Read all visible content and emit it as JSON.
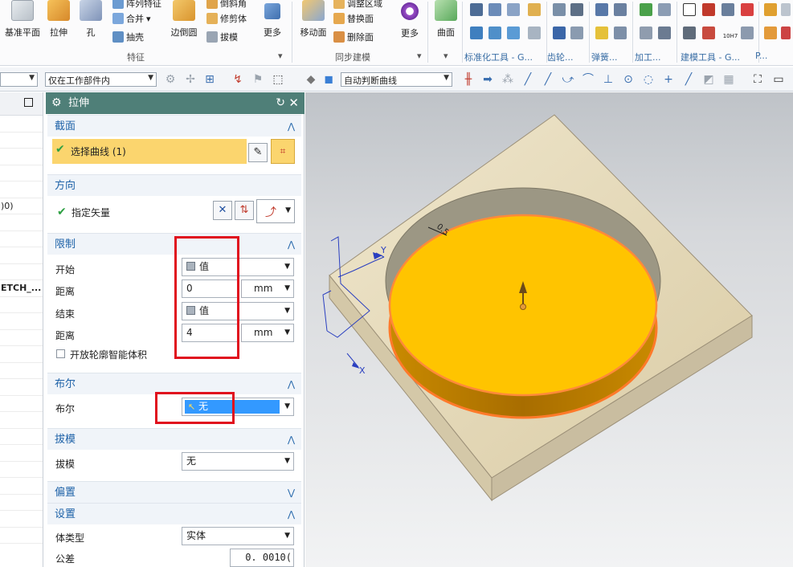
{
  "ribbon": {
    "large_buttons": [
      "基准平面",
      "拉伸",
      "孔",
      "边倒圆",
      "更多",
      "移动面",
      "更多",
      "曲面"
    ],
    "small_buttons": [
      "阵列特征",
      "合并",
      "抽壳",
      "倒斜角",
      "修剪体",
      "拔模",
      "调整区域",
      "替换面",
      "删除面"
    ],
    "groups": [
      "特征",
      "同步建模",
      "标准化工具 - G...",
      "齿轮...",
      "弹簧...",
      "加工...",
      "建模工具 - G...",
      "P..."
    ],
    "icon_labels": [
      "10H7"
    ]
  },
  "toolbar": {
    "filter_value": "仅在工作部件内",
    "curve_rule_value": "自动判断曲线"
  },
  "nav": {
    "rows": [
      "",
      "",
      "",
      "",
      "",
      ")0)",
      "",
      "",
      "",
      "",
      "ETCH_...",
      "",
      "",
      "",
      "",
      "",
      "",
      "",
      "",
      "",
      "",
      "",
      "",
      "",
      "",
      ""
    ]
  },
  "dialog": {
    "title": "拉伸",
    "sections": {
      "section": {
        "label": "截面",
        "select_curve": "选择曲线 (1)"
      },
      "direction": {
        "label": "方向",
        "vector": "指定矢量"
      },
      "limits": {
        "label": "限制",
        "start_label": "开始",
        "start_value": "值",
        "start_dist_label": "距离",
        "start_dist": "0",
        "unit1": "mm",
        "end_label": "结束",
        "end_value": "值",
        "end_dist_label": "距离",
        "end_dist": "4",
        "unit2": "mm",
        "open_profile": "开放轮廓智能体积"
      },
      "boolean": {
        "label": "布尔",
        "field_label": "布尔",
        "value": "无"
      },
      "draft": {
        "label": "拔模",
        "field_label": "拔模",
        "value": "无"
      },
      "offset": {
        "label": "偏置"
      },
      "settings": {
        "label": "设置",
        "body_type_label": "体类型",
        "body_type": "实体",
        "tolerance_label": "公差",
        "tolerance": "0. 0010("
      }
    }
  },
  "viewport": {
    "axis_y": "Y",
    "axis_x": "X",
    "dimension": "0.5"
  },
  "colors": {
    "dialog_title_bg": "#4f7f78",
    "section_fg": "#1e62a8",
    "highlight": "#fbd56e",
    "selection_blue": "#3399ff",
    "callout_red": "#e0101e",
    "cylinder": "#ffc400",
    "plate": "#e3d7b6"
  }
}
